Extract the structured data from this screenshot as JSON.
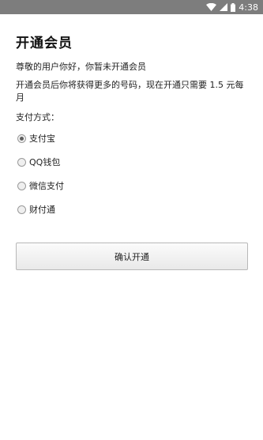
{
  "status_bar": {
    "time": "4:38",
    "icons": [
      "wifi-icon",
      "signal-icon",
      "battery-icon"
    ]
  },
  "page": {
    "title": "开通会员",
    "greeting": "尊敬的用户你好，你暂未开通会员",
    "promo": "开通会员后你将获得更多的号码，现在开通只需要 1.5 元每月",
    "payment_label": "支付方式："
  },
  "payment_options": [
    {
      "label": "支付宝",
      "checked": true
    },
    {
      "label": "QQ钱包",
      "checked": false
    },
    {
      "label": "微信支付",
      "checked": false
    },
    {
      "label": "财付通",
      "checked": false
    }
  ],
  "confirm_label": "确认开通",
  "colors": {
    "status_bar": "#7d7d7d",
    "background": "#ffffff",
    "text": "#222222"
  }
}
